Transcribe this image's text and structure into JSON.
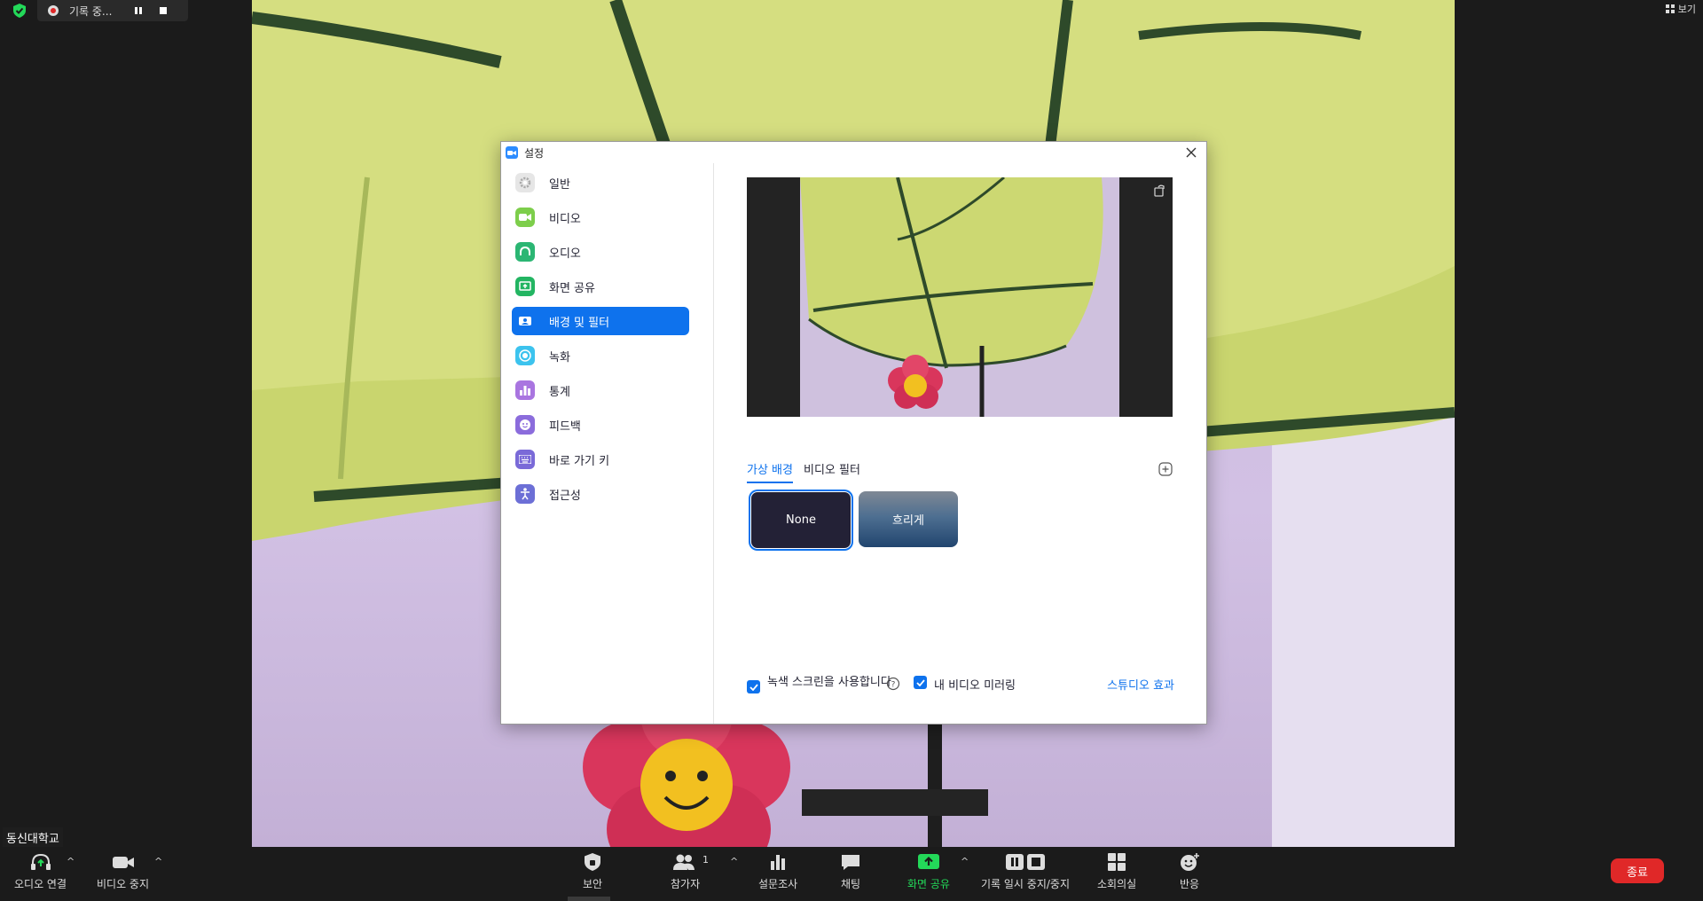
{
  "recording": {
    "label": "기록 중..."
  },
  "top_right": {
    "view_label": "보기"
  },
  "dialog": {
    "title": "설정",
    "nav": [
      {
        "label": "일반",
        "icon": "gear-icon",
        "color": "#c8c8c8"
      },
      {
        "label": "비디오",
        "icon": "camera-icon",
        "color": "#7dce4b"
      },
      {
        "label": "오디오",
        "icon": "headphones-icon",
        "color": "#2bb673"
      },
      {
        "label": "화면 공유",
        "icon": "share-screen-icon",
        "color": "#23b562"
      },
      {
        "label": "배경 및 필터",
        "icon": "background-icon",
        "color": "#0e72ed"
      },
      {
        "label": "녹화",
        "icon": "record-icon",
        "color": "#3cc3ee"
      },
      {
        "label": "통계",
        "icon": "chart-icon",
        "color": "#a975e0"
      },
      {
        "label": "피드백",
        "icon": "smile-icon",
        "color": "#8b6cdc"
      },
      {
        "label": "바로 가기 키",
        "icon": "keyboard-icon",
        "color": "#7a6ad8"
      },
      {
        "label": "접근성",
        "icon": "accessibility-icon",
        "color": "#6c6fd6"
      }
    ],
    "tabs": {
      "virtual_bg": "가상 배경",
      "video_filter": "비디오 필터"
    },
    "backgrounds": {
      "none": "None",
      "blur": "흐리게"
    },
    "green_screen": "녹색 스크린을 사용합니다",
    "mirror": "내 비디오 미러링",
    "studio": "스튜디오 효과"
  },
  "name_tag": "동신대학교",
  "toolbar": {
    "audio": "오디오 연결",
    "video": "비디오 중지",
    "security": "보안",
    "participants": "참가자",
    "participants_count": "1",
    "polls": "설문조사",
    "chat": "채팅",
    "share": "화면 공유",
    "record": "기록 일시 중지/중지",
    "breakout": "소회의실",
    "reactions": "반응",
    "end": "종료"
  },
  "colors": {
    "accent": "#0e72ed",
    "end": "#e02828",
    "share_green": "#23d959"
  }
}
